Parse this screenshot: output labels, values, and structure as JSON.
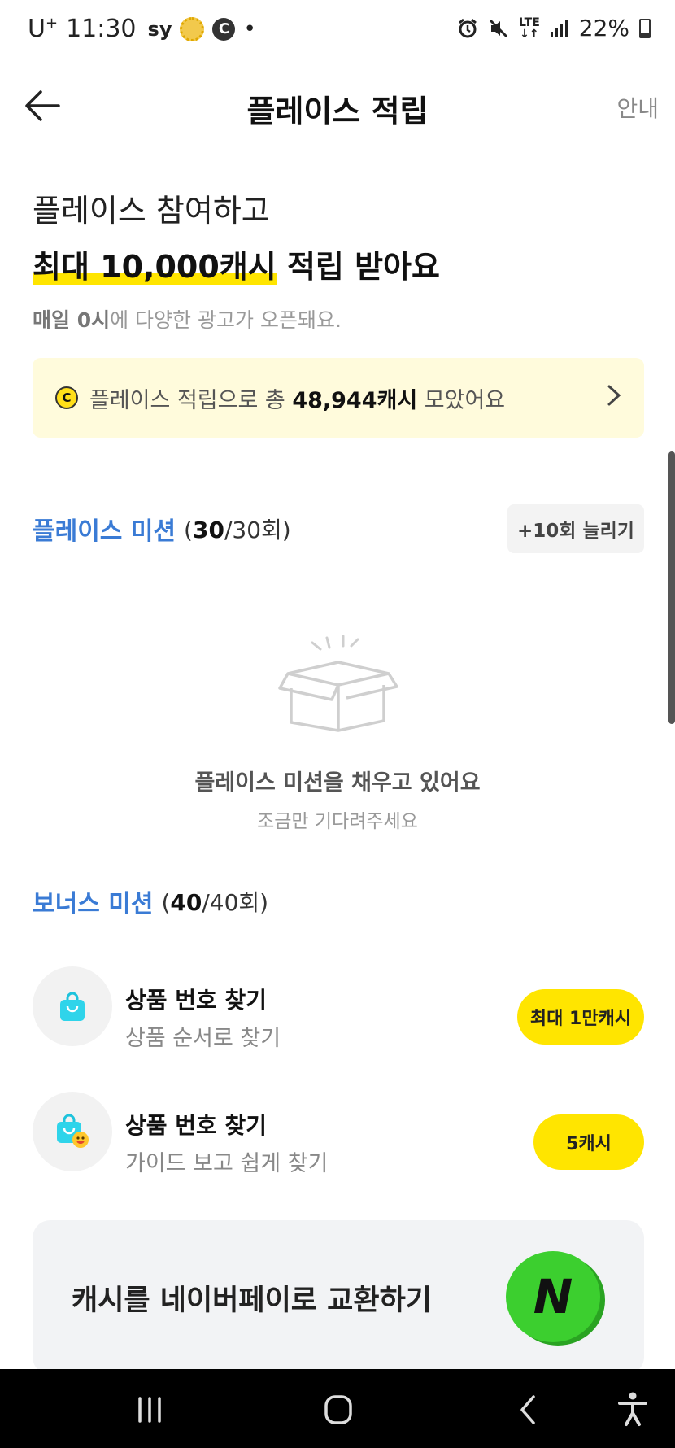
{
  "status_bar": {
    "carrier": "U",
    "carrier_sup": "+",
    "time": "11:30",
    "sy": "sy",
    "c_badge": "C",
    "dot": "•",
    "lte": "LTE",
    "battery": "22%"
  },
  "header": {
    "title": "플레이스 적립",
    "guide_label": "안내"
  },
  "hero": {
    "line1": "플레이스 참여하고",
    "line2_highlight": "최대 10,000캐시",
    "line2_rest": " 적립 받아요",
    "sub_bold": "매일 0시",
    "sub_rest": "에 다양한 광고가 오픈돼요."
  },
  "total": {
    "coin_letter": "C",
    "prefix": "플레이스 적립으로 총 ",
    "amount": "48,944캐시",
    "suffix": " 모았어요"
  },
  "place_mission": {
    "name": "플레이스 미션",
    "count_open": "(",
    "done": "30",
    "total": "/30회)",
    "add_button": "+10회 늘리기",
    "empty_title": "플레이스 미션을 채우고 있어요",
    "empty_sub": "조금만 기다려주세요"
  },
  "bonus_mission": {
    "name": "보너스 미션",
    "count_open": "(",
    "done": "40",
    "total": "/40회)",
    "items": [
      {
        "title": "상품 번호 찾기",
        "subtitle": "상품 순서로 찾기",
        "reward": "최대 1만캐시"
      },
      {
        "title": "상품 번호 찾기",
        "subtitle": "가이드 보고 쉽게 찾기",
        "reward": "5캐시"
      }
    ]
  },
  "exchange": {
    "label": "캐시를 네이버페이로 교환하기",
    "logo_letter": "N"
  },
  "colors": {
    "accent_blue": "#3a7bd5",
    "yellow": "#ffe500",
    "light_yellow_bg": "#fffbdc",
    "naver_green": "#3ccf2f"
  },
  "icons": [
    "arrow-left-icon",
    "chevron-right-icon",
    "coin-icon",
    "empty-box-icon",
    "shopping-bag-icon",
    "naver-coin-icon",
    "recents-icon",
    "home-icon",
    "back-icon",
    "accessibility-icon"
  ]
}
